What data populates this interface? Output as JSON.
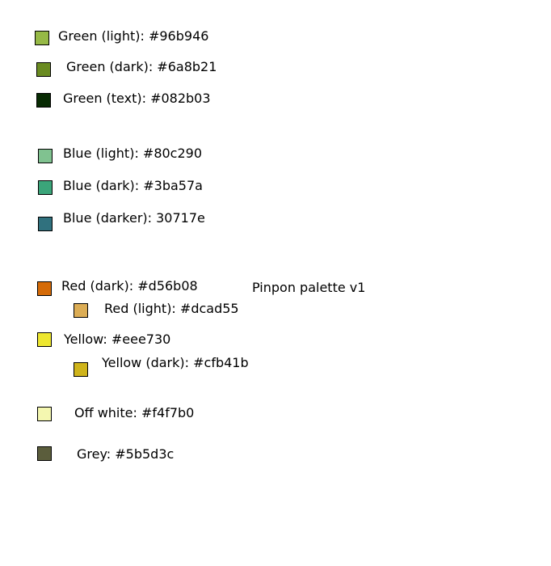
{
  "title": "Pinpon palette v1",
  "colors": [
    {
      "label": "Green (light): #96b946",
      "hex": "#96b946"
    },
    {
      "label": "Green (dark): #6a8b21",
      "hex": "#6a8b21"
    },
    {
      "label": "Green (text): #082b03",
      "hex": "#082b03"
    },
    {
      "label": "Blue (light): #80c290",
      "hex": "#80c290"
    },
    {
      "label": "Blue (dark): #3ba57a",
      "hex": "#3ba57a"
    },
    {
      "label": "Blue (darker): 30717e",
      "hex": "#30717e"
    },
    {
      "label": "Red (dark): #d56b08",
      "hex": "#d56b08"
    },
    {
      "label": "Red (light): #dcad55",
      "hex": "#dcad55"
    },
    {
      "label": "Yellow: #eee730",
      "hex": "#eee730"
    },
    {
      "label": "Yellow (dark): #cfb41b",
      "hex": "#cfb41b"
    },
    {
      "label": "Off white: #f4f7b0",
      "hex": "#f4f7b0"
    },
    {
      "label": "Grey: #5b5d3c",
      "hex": "#5b5d3c"
    }
  ]
}
